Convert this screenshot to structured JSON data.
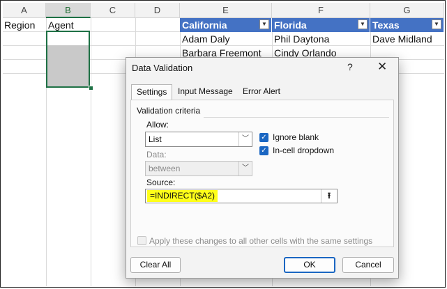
{
  "sheet": {
    "columns": [
      "A",
      "B",
      "C",
      "D",
      "E",
      "F",
      "G"
    ],
    "cells": {
      "a1": "Region",
      "b1": "Agent"
    },
    "table": {
      "headers": [
        "California",
        "Florida",
        "Texas"
      ],
      "rows": [
        [
          "Adam Daly",
          "Phil Daytona",
          "Dave Midland"
        ],
        [
          "Barbara Freemont",
          "Cindy Orlando",
          ""
        ]
      ]
    }
  },
  "dialog": {
    "title": "Data Validation",
    "help": "?",
    "close": "✕",
    "tabs": [
      "Settings",
      "Input Message",
      "Error Alert"
    ],
    "active_tab": "Settings",
    "section_title": "Validation criteria",
    "allow_label": "Allow:",
    "allow_value": "List",
    "data_label": "Data:",
    "data_value": "between",
    "ignore_blank": "Ignore blank",
    "incell_dropdown": "In-cell dropdown",
    "source_label": "Source:",
    "source_value": "=INDIRECT($A2)",
    "apply_all": "Apply these changes to all other cells with the same settings",
    "clear_all": "Clear All",
    "ok": "OK",
    "cancel": "Cancel"
  },
  "colors": {
    "table_header": "#4472c4",
    "selection": "#1e7145",
    "highlight": "#ffff1a",
    "accent": "#1a66c2"
  }
}
